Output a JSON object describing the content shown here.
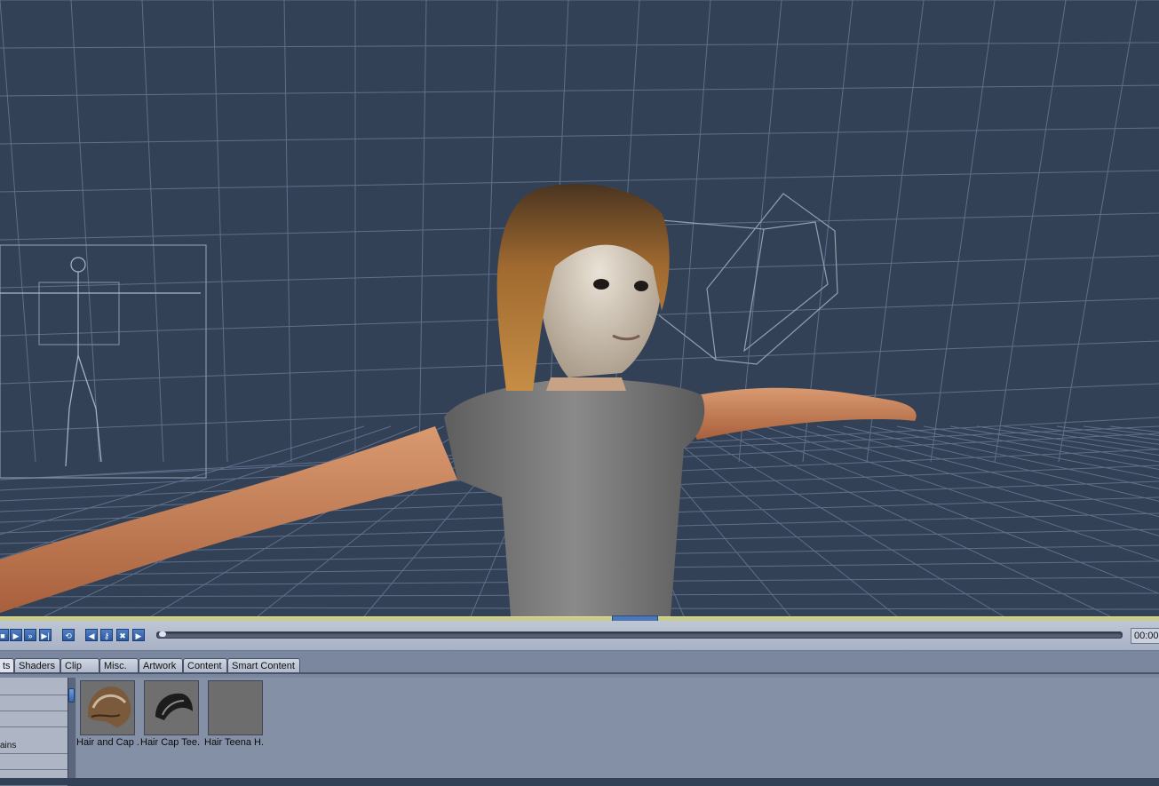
{
  "timeline": {
    "timecode": "00:00",
    "buttons": [
      "stop",
      "play",
      "fast-forward",
      "last-frame",
      "loop",
      "prev-key",
      "key",
      "delete-key",
      "next-key"
    ]
  },
  "library": {
    "tabs": [
      {
        "label": "ts",
        "active": true
      },
      {
        "label": "Shaders",
        "active": false
      },
      {
        "label": "Clip",
        "active": false
      },
      {
        "label": "Misc.",
        "active": false
      },
      {
        "label": "Artwork",
        "active": false
      },
      {
        "label": "Content",
        "active": false
      },
      {
        "label": "Smart Content",
        "active": false
      }
    ],
    "categories": [
      "",
      "",
      "",
      "ains",
      "",
      ""
    ],
    "items": [
      {
        "label": "Hair and Cap .",
        "icon": "hair-cap-thumbnail"
      },
      {
        "label": "Hair Cap Tee.",
        "icon": "cap-shape-thumbnail"
      },
      {
        "label": "Hair Teena H.",
        "icon": "empty-thumbnail"
      }
    ]
  },
  "colors": {
    "viewport_bg": "#334157",
    "grid_line": "#5f6f8a",
    "skin": "#c9835c",
    "shirt": "#6f6f6f",
    "hair": "#9a6a34",
    "accent_blue": "#3d6cb5"
  }
}
